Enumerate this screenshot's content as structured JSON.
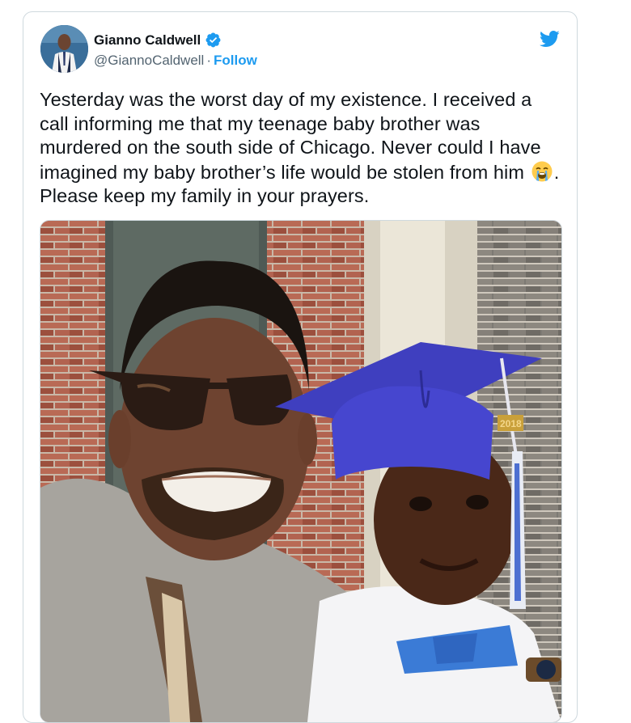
{
  "author": {
    "display_name": "Gianno Caldwell",
    "handle": "@GiannoCaldwell",
    "separator": "·",
    "follow_label": "Follow",
    "verified_badge_icon": "verified-badge-icon",
    "avatar_icon": "avatar"
  },
  "app_icon": "twitter-bird-icon",
  "tweet": {
    "text_before_emoji": "Yesterday was the worst day of my existence. I received a call informing me that my teenage baby brother was murdered on the south side of Chicago. Never could I have imagined my baby brother’s life would be stolen from him ",
    "emoji": "loudly-crying-face-icon",
    "text_after_emoji": ". Please keep my family in your prayers."
  },
  "media": {
    "type": "photo",
    "cap_tassel_text": "2018"
  },
  "colors": {
    "accent": "#1d9bf0",
    "text": "#0f1419",
    "secondary": "#536471",
    "border": "#cfd9de"
  }
}
